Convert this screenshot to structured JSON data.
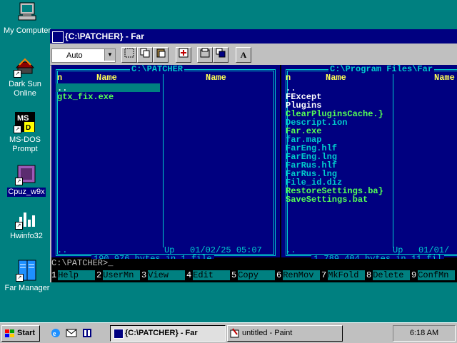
{
  "desktop": {
    "icons": [
      {
        "label": "My Computer"
      },
      {
        "label": "Dark Sun Online"
      },
      {
        "label": "MS-DOS Prompt"
      },
      {
        "label": "Cpuz_w9x"
      },
      {
        "label": "Hwinfo32"
      },
      {
        "label": "Far Manager"
      }
    ]
  },
  "window": {
    "title": "{C:\\PATCHER} - Far",
    "font_size": "Auto",
    "toolbar_a": "A"
  },
  "left_panel": {
    "title": " C:\\PATCHER ",
    "col1_n": "n",
    "col1_name": "Name",
    "col2_name": "Name",
    "files": [
      {
        "name": "..",
        "type": "dir"
      },
      {
        "name": "gtx_fix.exe",
        "type": "exe"
      }
    ],
    "status_name": "..",
    "status_info": "Up   01/02/25 05:07",
    "footer": "190,976 bytes in 1 file"
  },
  "right_panel": {
    "title": " C:\\Program Files\\Far",
    "col1_n": "n",
    "col1_name": "Name",
    "col2_name": "Name",
    "files": [
      {
        "name": "..",
        "type": "dir"
      },
      {
        "name": "FExcept",
        "type": "dir"
      },
      {
        "name": "Plugins",
        "type": "dir"
      },
      {
        "name": "ClearPluginsCache.}",
        "type": "exe"
      },
      {
        "name": "Descript.ion",
        "type": "txt"
      },
      {
        "name": "Far.exe",
        "type": "exe"
      },
      {
        "name": "far.map",
        "type": "txt"
      },
      {
        "name": "FarEng.hlf",
        "type": "txt"
      },
      {
        "name": "FarEng.lng",
        "type": "txt"
      },
      {
        "name": "FarRus.hlf",
        "type": "txt"
      },
      {
        "name": "FarRus.lng",
        "type": "txt"
      },
      {
        "name": "File_id.diz",
        "type": "txt"
      },
      {
        "name": "RestoreSettings.ba}",
        "type": "exe"
      },
      {
        "name": "SaveSettings.bat",
        "type": "exe"
      }
    ],
    "status_name": "..",
    "status_info": "Up   01/01/",
    "footer": "1,789,404 bytes in 11 fil"
  },
  "cmdline": "C:\\PATCHER>_",
  "keybar": [
    {
      "n": "1",
      "label": "Help"
    },
    {
      "n": "2",
      "label": "UserMn"
    },
    {
      "n": "3",
      "label": "View"
    },
    {
      "n": "4",
      "label": "Edit"
    },
    {
      "n": "5",
      "label": "Copy"
    },
    {
      "n": "6",
      "label": "RenMov"
    },
    {
      "n": "7",
      "label": "MkFold"
    },
    {
      "n": "8",
      "label": "Delete"
    },
    {
      "n": "9",
      "label": "ConfMn"
    }
  ],
  "taskbar": {
    "start": "Start",
    "tasks": [
      {
        "label": "{C:\\PATCHER} - Far",
        "active": true
      },
      {
        "label": "untitled - Paint",
        "active": false
      }
    ],
    "clock": "6:18 AM"
  },
  "colors": {
    "desktop": "#008080",
    "title_active": "#000080",
    "panel_bg": "#000080",
    "panel_frame": "#00cccc",
    "header_text": "#ffff55",
    "exec_file": "#55ff55"
  }
}
